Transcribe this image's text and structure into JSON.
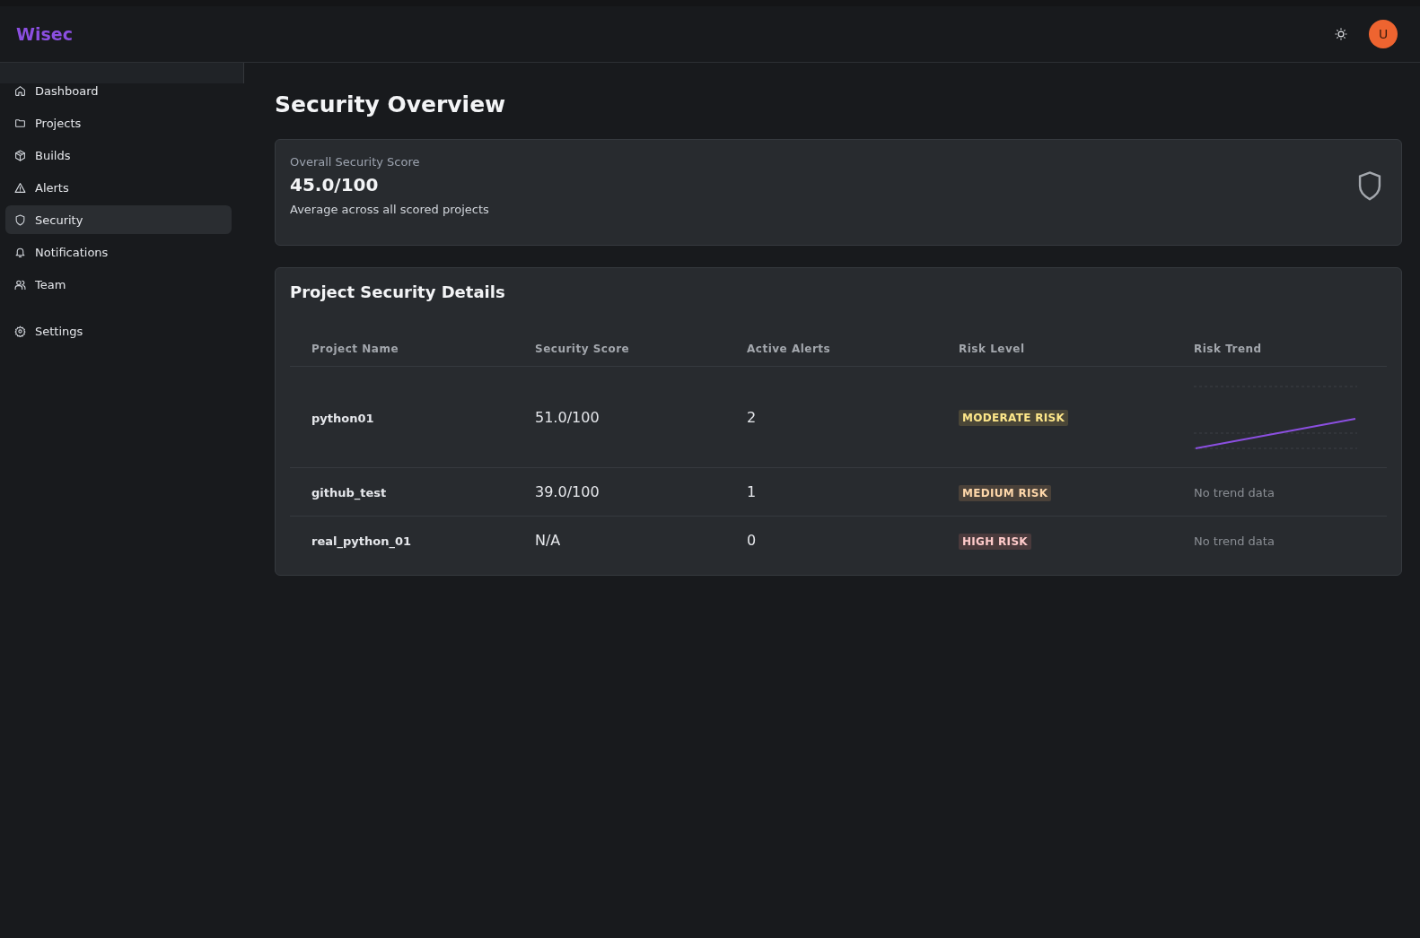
{
  "brand": "Wisec",
  "header": {
    "avatar": "U"
  },
  "sidebar": {
    "items": [
      {
        "label": "Dashboard",
        "selected": false
      },
      {
        "label": "Projects",
        "selected": false
      },
      {
        "label": "Builds",
        "selected": false
      },
      {
        "label": "Alerts",
        "selected": false
      },
      {
        "label": "Security",
        "selected": true
      },
      {
        "label": "Notifications",
        "selected": false
      },
      {
        "label": "Team",
        "selected": false
      }
    ],
    "footer_items": [
      {
        "label": "Settings",
        "selected": false
      }
    ]
  },
  "page_title": "Security Overview",
  "score_card": {
    "label": "Overall Security Score",
    "value": "45.0/100",
    "caption": "Average across all scored projects"
  },
  "details": {
    "title": "Project Security Details",
    "columns": [
      "Project Name",
      "Security Score",
      "Active Alerts",
      "Risk Level",
      "Risk Trend"
    ],
    "rows": [
      {
        "name": "python01",
        "score": "51.0/100",
        "alerts": "2",
        "risk": "MODERATE RISK",
        "kind": "moderate",
        "trend": {
          "kind": "sparkline"
        }
      },
      {
        "name": "github_test",
        "score": "39.0/100",
        "alerts": "1",
        "risk": "MEDIUM RISK",
        "kind": "medium",
        "trend": {
          "kind": "text",
          "text": "No trend data"
        }
      },
      {
        "name": "real_python_01",
        "score": "N/A",
        "alerts": "0",
        "risk": "HIGH RISK",
        "kind": "high",
        "trend": {
          "kind": "text",
          "text": "No trend data"
        }
      }
    ]
  }
}
